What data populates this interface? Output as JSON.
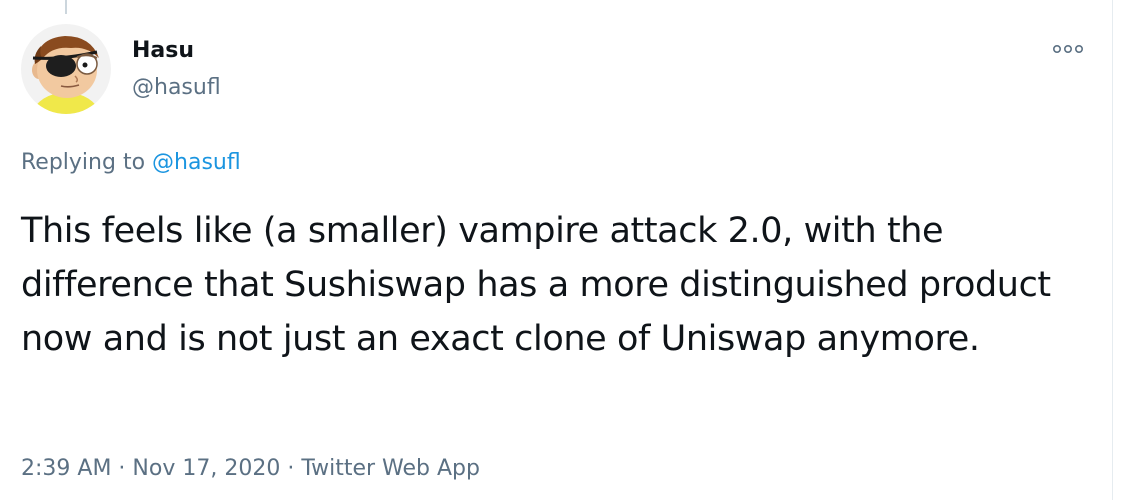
{
  "author": {
    "display_name": "Hasu",
    "handle": "@hasufl"
  },
  "reply": {
    "prefix": "Replying to ",
    "mention": "@hasufl"
  },
  "tweet": {
    "text": "This feels like (a smaller) vampire attack 2.0, with the difference that Sushiswap has a more distinguished product now and is not just an exact clone of Uniswap anymore."
  },
  "meta": {
    "time": "2:39 AM",
    "separator_1": " · ",
    "date": "Nov 17, 2020",
    "separator_2": " · ",
    "source": "Twitter Web App"
  },
  "icons": {
    "avatar": "cartoon-eyepatch-avatar",
    "more": "more-options-icon"
  },
  "colors": {
    "text_primary": "#0f1419",
    "text_secondary": "#5b7083",
    "link": "#1b95e0",
    "thread_line": "#ccd6dd",
    "border": "#e6ecf0"
  }
}
